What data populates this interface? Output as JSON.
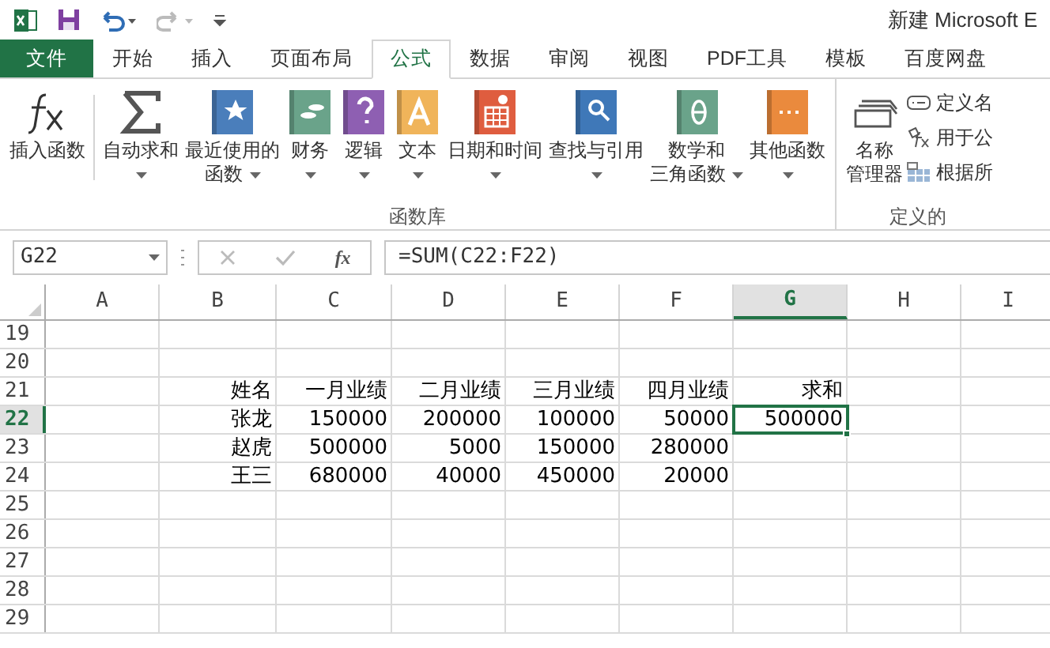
{
  "window": {
    "title": "新建 Microsoft E"
  },
  "tabs": [
    {
      "label": "文件",
      "kind": "file",
      "selected": false
    },
    {
      "label": "开始",
      "kind": "tab",
      "selected": false
    },
    {
      "label": "插入",
      "kind": "tab",
      "selected": false
    },
    {
      "label": "页面布局",
      "kind": "tab",
      "selected": false
    },
    {
      "label": "公式",
      "kind": "tab",
      "selected": true
    },
    {
      "label": "数据",
      "kind": "tab",
      "selected": false
    },
    {
      "label": "审阅",
      "kind": "tab",
      "selected": false
    },
    {
      "label": "视图",
      "kind": "tab",
      "selected": false
    },
    {
      "label": "PDF工具",
      "kind": "tab",
      "selected": false
    },
    {
      "label": "模板",
      "kind": "tab",
      "selected": false
    },
    {
      "label": "百度网盘",
      "kind": "tab",
      "selected": false
    }
  ],
  "ribbon": {
    "groups": [
      {
        "label": "函数库",
        "buttons": [
          {
            "lines": [
              "插入函数"
            ],
            "dropdown": false
          },
          {
            "lines": [
              "自动求和"
            ],
            "dropdown": true
          },
          {
            "lines": [
              "最近使用的",
              "函数"
            ],
            "dropdown": true
          },
          {
            "lines": [
              "财务"
            ],
            "dropdown": true
          },
          {
            "lines": [
              "逻辑"
            ],
            "dropdown": true
          },
          {
            "lines": [
              "文本"
            ],
            "dropdown": true
          },
          {
            "lines": [
              "日期和时间"
            ],
            "dropdown": true
          },
          {
            "lines": [
              "查找与引用"
            ],
            "dropdown": true
          },
          {
            "lines": [
              "数学和",
              "三角函数"
            ],
            "dropdown": true
          },
          {
            "lines": [
              "其他函数"
            ],
            "dropdown": true
          }
        ]
      },
      {
        "label": "定义的",
        "buttons": [
          {
            "lines": [
              "名称",
              "管理器"
            ],
            "dropdown": false
          }
        ],
        "small_buttons": [
          "定义名",
          "用于公",
          "根据所"
        ]
      }
    ]
  },
  "formula_bar": {
    "name_box": "G22",
    "fx": "fx",
    "formula": "=SUM(C22:F22)"
  },
  "sheet": {
    "columns": [
      {
        "label": "A",
        "selected": false
      },
      {
        "label": "B",
        "selected": false
      },
      {
        "label": "C",
        "selected": false
      },
      {
        "label": "D",
        "selected": false
      },
      {
        "label": "E",
        "selected": false
      },
      {
        "label": "F",
        "selected": false
      },
      {
        "label": "G",
        "selected": true
      },
      {
        "label": "H",
        "selected": false
      },
      {
        "label": "I",
        "selected": false
      }
    ],
    "rows": [
      {
        "number": "19",
        "selected": false,
        "cells": []
      },
      {
        "number": "20",
        "selected": false,
        "cells": []
      },
      {
        "number": "21",
        "selected": false,
        "cells": [
          null,
          "姓名",
          "一月业绩",
          "二月业绩",
          "三月业绩",
          "四月业绩",
          "求和"
        ]
      },
      {
        "number": "22",
        "selected": true,
        "cells": [
          null,
          "张龙",
          "150000",
          "200000",
          "100000",
          "50000",
          "500000"
        ]
      },
      {
        "number": "23",
        "selected": false,
        "cells": [
          null,
          "赵虎",
          "500000",
          "5000",
          "150000",
          "280000"
        ]
      },
      {
        "number": "24",
        "selected": false,
        "cells": [
          null,
          "王三",
          "680000",
          "40000",
          "450000",
          "20000"
        ]
      },
      {
        "number": "25",
        "selected": false,
        "cells": []
      },
      {
        "number": "26",
        "selected": false,
        "cells": []
      },
      {
        "number": "27",
        "selected": false,
        "cells": []
      },
      {
        "number": "28",
        "selected": false,
        "cells": []
      },
      {
        "number": "29",
        "selected": false,
        "cells": []
      }
    ]
  }
}
